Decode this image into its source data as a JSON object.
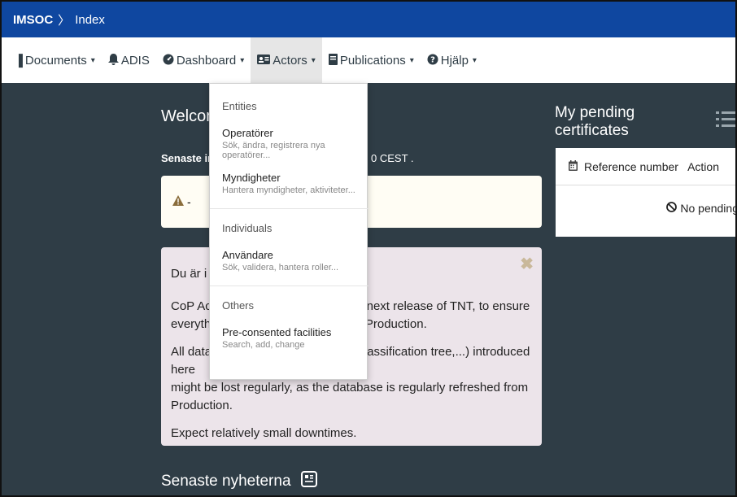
{
  "topbar": {
    "brand": "IMSOC",
    "separator": "〉",
    "breadcrumb": "Index"
  },
  "nav": [
    {
      "label": "Documents",
      "icon": "document-icon",
      "glyph": "▐",
      "caret": true
    },
    {
      "label": "ADIS",
      "icon": "bell-icon",
      "glyph": "🔔",
      "caret": false
    },
    {
      "label": "Dashboard",
      "icon": "dashboard-icon",
      "glyph": "◍",
      "caret": true
    },
    {
      "label": "Actors",
      "icon": "id-card-icon",
      "glyph": "▦",
      "caret": true
    },
    {
      "label": "Publications",
      "icon": "book-icon",
      "glyph": "▤",
      "caret": true
    },
    {
      "label": "Hjälp",
      "icon": "question-icon",
      "glyph": "❓",
      "caret": true
    }
  ],
  "caret_glyph": "▾",
  "welcome": {
    "title": "Welcome",
    "last_login_label": "Senaste in",
    "last_login_tail": "0 CEST ."
  },
  "alert": {
    "icon": "warning-icon",
    "glyph": "▲",
    "text": "-"
  },
  "notice": {
    "title": "Du är i m",
    "p1_a": "CoP Acce",
    "p1_b": "next release of TNT, to ensure",
    "p1_c": "everythin",
    "p1_d": "Production.",
    "p2_a": "All data (",
    "p2_b": "assification tree,...) introduced here",
    "p2_c": "might be lost regularly, as the database is regularly refreshed from Production.",
    "p3": "Expect relatively small downtimes.",
    "close_glyph": "✖"
  },
  "news": {
    "title": "Senaste nyheterna",
    "icon": "newspaper-icon"
  },
  "pending": {
    "title": "My pending certificates",
    "col_reference": "Reference number",
    "col_action": "Action",
    "empty": "No pending"
  },
  "dropdown": {
    "groups": [
      {
        "header": "Entities",
        "items": [
          {
            "title": "Operatörer",
            "sub": "Sök, ändra, registrera nya operatörer..."
          },
          {
            "title": "Myndigheter",
            "sub": "Hantera myndigheter, aktiviteter..."
          }
        ]
      },
      {
        "header": "Individuals",
        "items": [
          {
            "title": "Användare",
            "sub": "Sök, validera, hantera roller..."
          }
        ]
      },
      {
        "header": "Others",
        "items": [
          {
            "title": "Pre-consented facilities",
            "sub": "Search, add, change"
          }
        ]
      }
    ]
  }
}
